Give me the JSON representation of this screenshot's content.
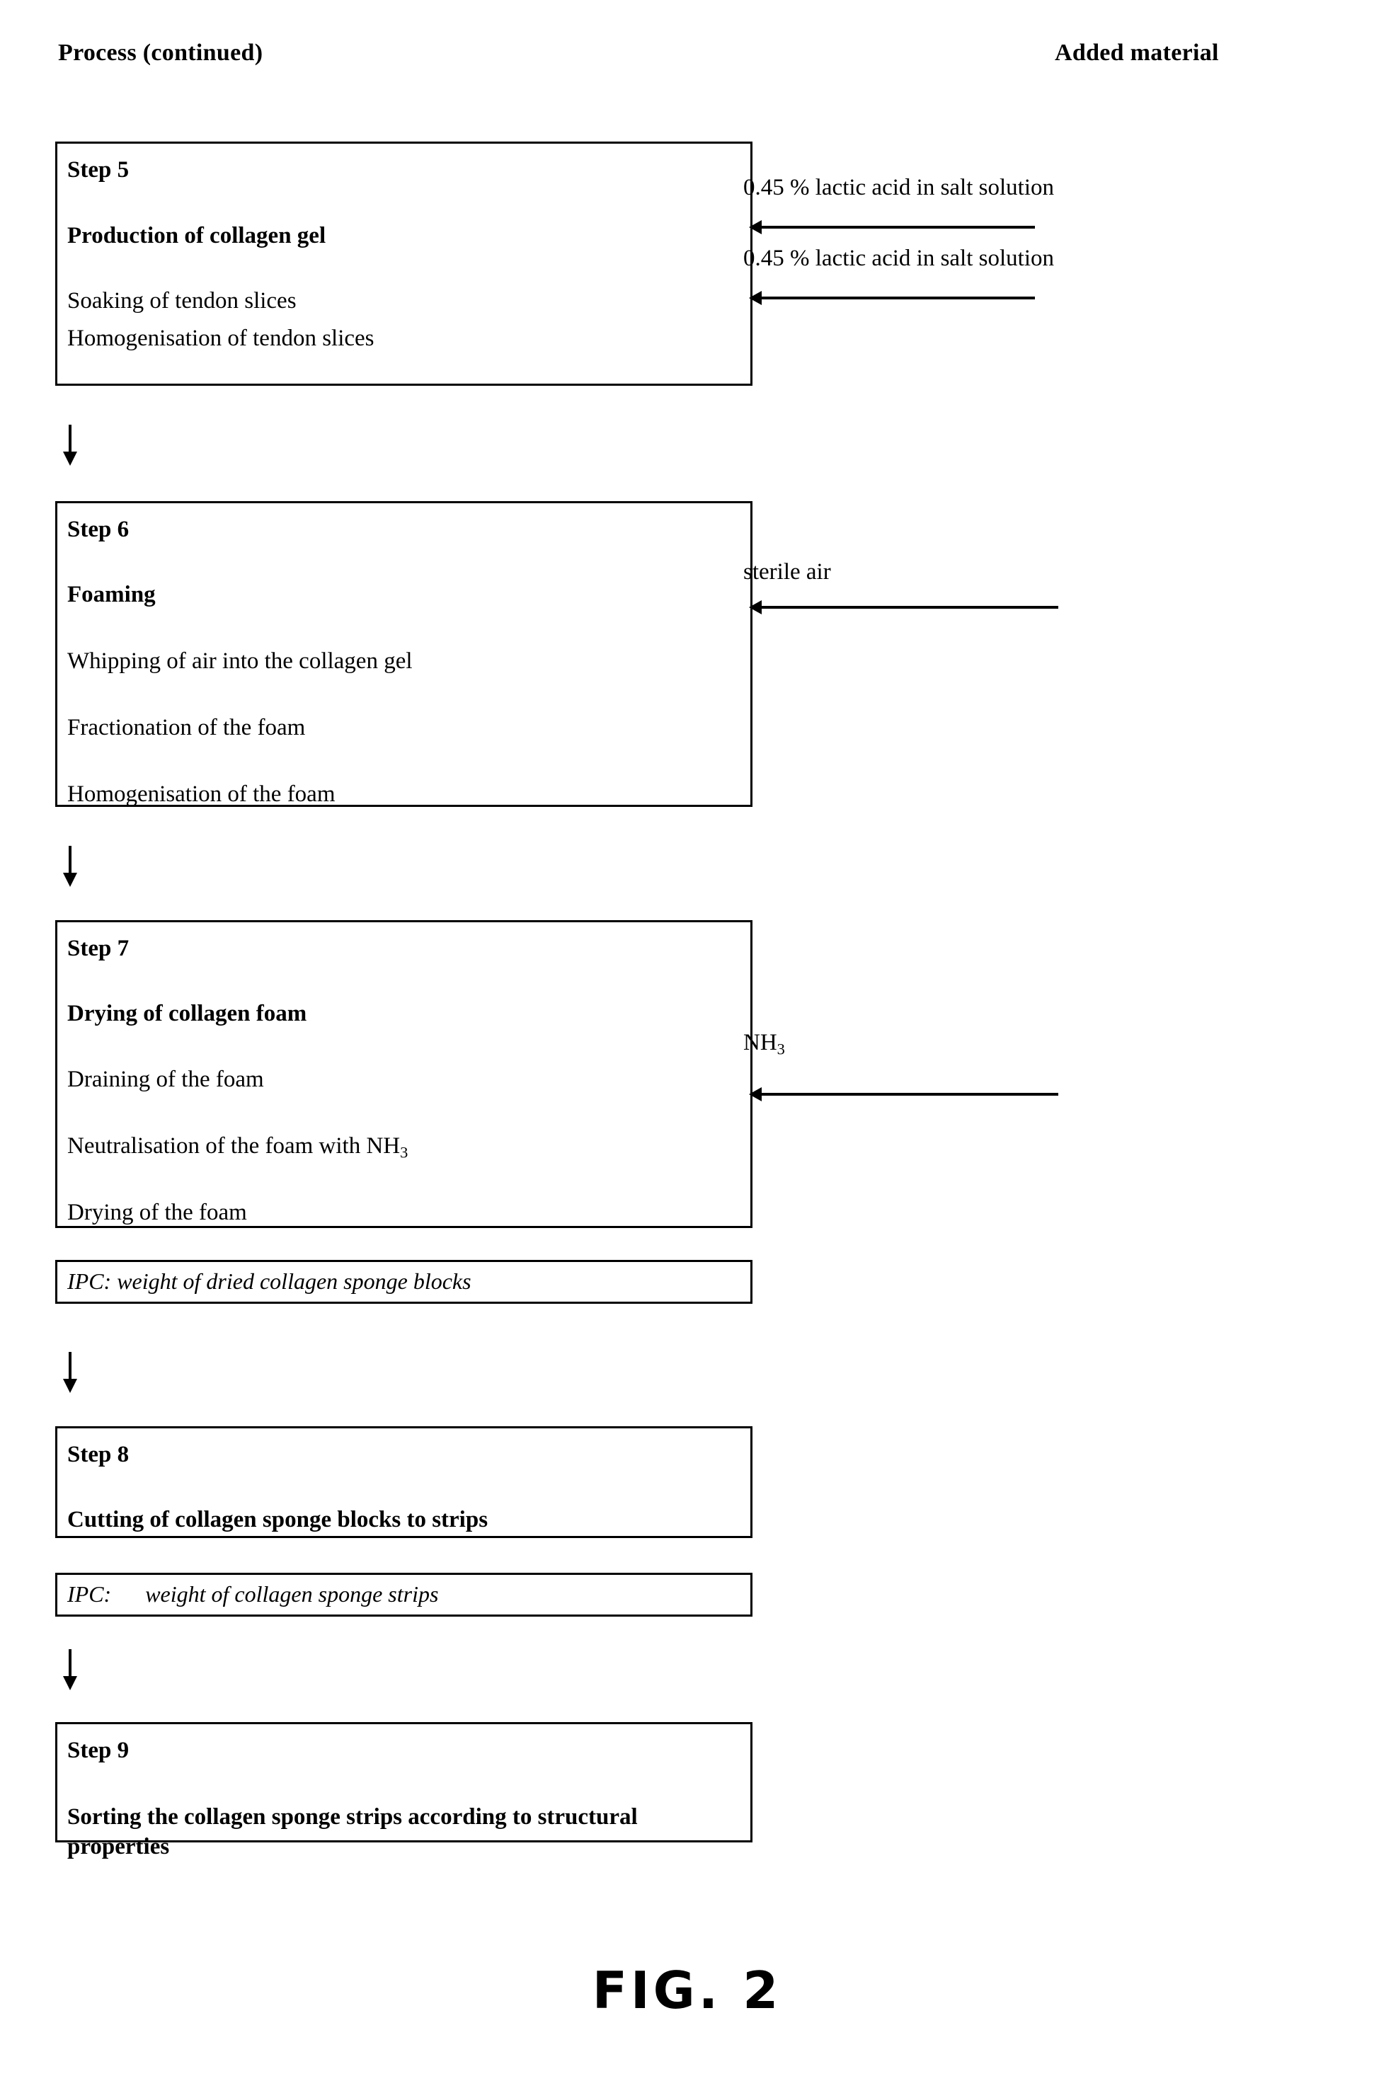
{
  "figure": {
    "caption": "FIG. 2",
    "columns": {
      "process_header": "Process (continued)",
      "added_material_header": "Added material"
    }
  },
  "steps": [
    {
      "id": "step-5",
      "number": "Step 5",
      "title": "Production of collagen gel",
      "operations": [
        "Soaking of tendon slices",
        "Homogenisation of tendon slices"
      ]
    },
    {
      "id": "step-6",
      "number": "Step 6",
      "title": "Foaming",
      "operations": [
        "Whipping of air into the collagen gel",
        "Fractionation of the foam",
        "Homogenisation of the foam"
      ]
    },
    {
      "id": "step-7",
      "number": "Step 7",
      "title": "Drying of collagen foam",
      "operations": [
        "Draining of the foam",
        "Neutralisation of the foam with NH3",
        "Drying of the foam"
      ]
    },
    {
      "id": "step-8",
      "number": "Step 8",
      "title": "Cutting of collagen sponge blocks to strips",
      "operations": []
    },
    {
      "id": "step-9",
      "number": "Step 9",
      "title": "Sorting the collagen sponge strips according to structural properties",
      "operations": []
    }
  ],
  "ipc_checks": [
    {
      "id": "ipc-1",
      "text": "IPC: weight of dried collagen sponge blocks"
    },
    {
      "id": "ipc-2",
      "text": "IPC:      weight of collagen sponge strips"
    }
  ],
  "added_materials": [
    {
      "id": "added-1",
      "label": "0.45 % lactic acid in salt solution",
      "target": "step-5"
    },
    {
      "id": "added-2",
      "label": "0.45 % lactic acid in salt solution",
      "target": "step-5"
    },
    {
      "id": "added-3",
      "label": "sterile air",
      "target": "step-6"
    },
    {
      "id": "added-4",
      "label": "NH3",
      "target": "step-7"
    }
  ],
  "flow_arrows": [
    {
      "id": "flow-1",
      "from": "step-5",
      "to": "step-6",
      "glyph": "down-arrow"
    },
    {
      "id": "flow-2",
      "from": "step-6",
      "to": "step-7",
      "glyph": "down-arrow"
    },
    {
      "id": "flow-3",
      "from": "ipc-1",
      "to": "step-8",
      "glyph": "down-arrow"
    },
    {
      "id": "flow-4",
      "from": "ipc-2",
      "to": "step-9",
      "glyph": "down-arrow"
    }
  ],
  "colors": {
    "ink": "#000000",
    "paper": "#ffffff"
  }
}
